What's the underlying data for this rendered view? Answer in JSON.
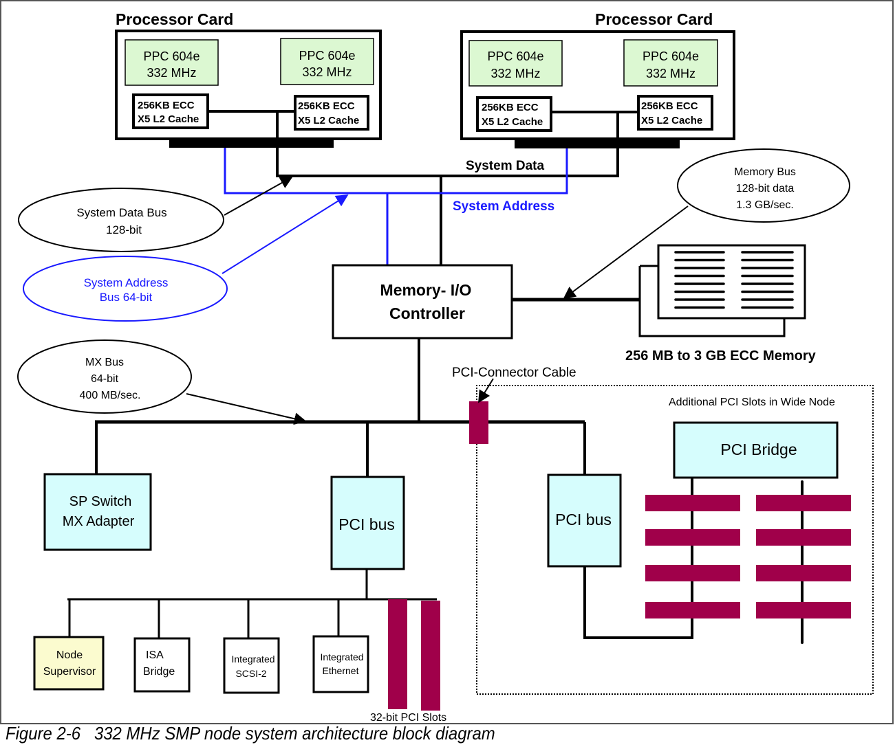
{
  "colors": {
    "cpu_fill": "#dcf8d2",
    "bus_box_fill": "#d6fdfd",
    "supervisor_fill": "#fbfbcf",
    "slot_fill": "#a0004a",
    "address_blue": "#1a1aff",
    "line": "#000000"
  },
  "processor_cards": [
    {
      "title": "Processor Card",
      "cpus": [
        {
          "line1": "PPC 604e",
          "line2": "332 MHz"
        },
        {
          "line1": "PPC 604e",
          "line2": "332 MHz"
        }
      ],
      "caches": [
        {
          "line1": "256KB  ECC",
          "line2": "X5 L2 Cache"
        },
        {
          "line1": "256KB  ECC",
          "line2": "X5 L2 Cache"
        }
      ]
    },
    {
      "title": "Processor Card",
      "cpus": [
        {
          "line1": "PPC 604e",
          "line2": "332 MHz"
        },
        {
          "line1": "PPC 604e",
          "line2": "332 MHz"
        }
      ],
      "caches": [
        {
          "line1": "256KB  ECC",
          "line2": "X5 L2 Cache"
        },
        {
          "line1": "256KB  ECC",
          "line2": "X5 L2 Cache"
        }
      ]
    }
  ],
  "bus_labels": {
    "system_data": "System Data",
    "system_address": "System Address"
  },
  "callouts": {
    "system_data_bus": {
      "line1": "System Data Bus",
      "line2": "128-bit"
    },
    "system_address_bus": {
      "line1": "System Address",
      "line2": "Bus 64-bit"
    },
    "memory_bus": {
      "line1": "Memory Bus",
      "line2": "128-bit data",
      "line3": "1.3 GB/sec."
    },
    "mx_bus": {
      "line1": "MX  Bus",
      "line2": "64-bit",
      "line3": "400 MB/sec."
    }
  },
  "controller": {
    "line1": "Memory- I/O",
    "line2": "Controller"
  },
  "memory": {
    "label": "256 MB to 3 GB ECC Memory"
  },
  "pci_connector_cable": "PCI-Connector Cable",
  "wide_node": {
    "label": "Additional PCI Slots  in Wide Node",
    "bridge": "PCI Bridge",
    "pci_bus": "PCI bus"
  },
  "sp_switch": {
    "line1": "SP Switch",
    "line2": "MX Adapter"
  },
  "pci_bus": "PCI bus",
  "devices": [
    {
      "line1": "Node",
      "line2": "Supervisor"
    },
    {
      "line1": "ISA",
      "line2": "Bridge"
    },
    {
      "line1": "Integrated",
      "line2": "SCSI-2"
    },
    {
      "line1": "Integrated",
      "line2": "Ethernet"
    }
  ],
  "pci_slots_label": "32-bit PCI Slots",
  "caption": "Figure 2-6   332 MHz SMP node system architecture block diagram"
}
